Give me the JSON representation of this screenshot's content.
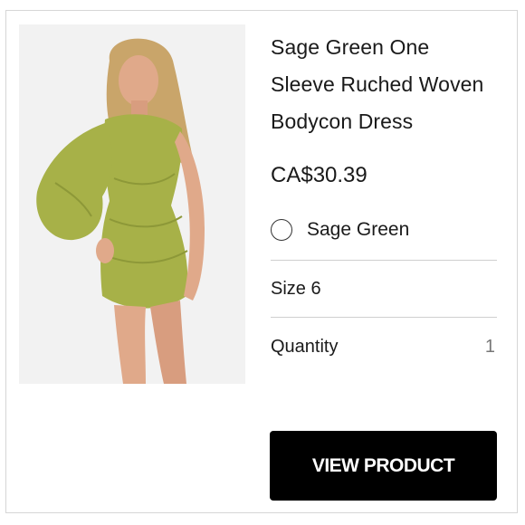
{
  "product": {
    "title": "Sage Green One Sleeve Ruched Woven Bodycon Dress",
    "price": "CA$30.39",
    "image_icon": "product-photo-dress",
    "colors": {
      "dress": "#a7b148",
      "dress_shadow": "#8d9838",
      "accent_button": "#000000"
    }
  },
  "options": {
    "color_label": "Sage Green",
    "color_selected": false,
    "size_label": "Size 6",
    "quantity_label": "Quantity",
    "quantity_value": "1"
  },
  "actions": {
    "view_product_label": "VIEW PRODUCT"
  }
}
